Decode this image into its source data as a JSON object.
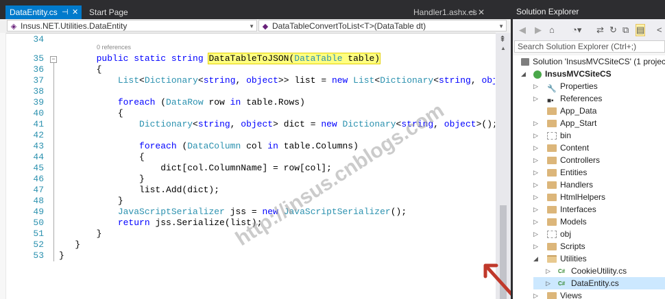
{
  "tabs": {
    "active": "DataEntity.cs",
    "second": "Start Page",
    "right": "Handler1.ashx.cs"
  },
  "nav": {
    "left": "Insus.NET.Utilities.DataEntity",
    "right": "DataTableConvertToList<T>(DataTable dt)"
  },
  "code": {
    "references": "0 references",
    "lines": [
      {
        "n": "34"
      },
      {
        "n": "35"
      },
      {
        "n": "36"
      },
      {
        "n": "37"
      },
      {
        "n": "38"
      },
      {
        "n": "39"
      },
      {
        "n": "40"
      },
      {
        "n": "41"
      },
      {
        "n": "42"
      },
      {
        "n": "43"
      },
      {
        "n": "44"
      },
      {
        "n": "45"
      },
      {
        "n": "46"
      },
      {
        "n": "47"
      },
      {
        "n": "48"
      },
      {
        "n": "49"
      },
      {
        "n": "50"
      },
      {
        "n": "51"
      },
      {
        "n": "52"
      },
      {
        "n": "53"
      }
    ]
  },
  "solution_explorer": {
    "title": "Solution Explorer",
    "search_placeholder": "Search Solution Explorer (Ctrl+;)",
    "solution": "Solution 'InsusMVCSiteCS' (1 projec",
    "project": "InsusMVCSiteCS",
    "items": [
      "Properties",
      "References",
      "App_Data",
      "App_Start",
      "bin",
      "Content",
      "Controllers",
      "Entities",
      "Handlers",
      "HtmlHelpers",
      "Interfaces",
      "Models",
      "obj",
      "Scripts",
      "Utilities",
      "CookieUtility.cs",
      "DataEntity.cs",
      "Views"
    ]
  },
  "watermark": "http://insus.cnblogs.com",
  "colors": {
    "accent": "#007acc",
    "keyword": "#0000ff",
    "type": "#2b91af",
    "highlight": "#ffff80",
    "arrow": "#c0392b"
  }
}
